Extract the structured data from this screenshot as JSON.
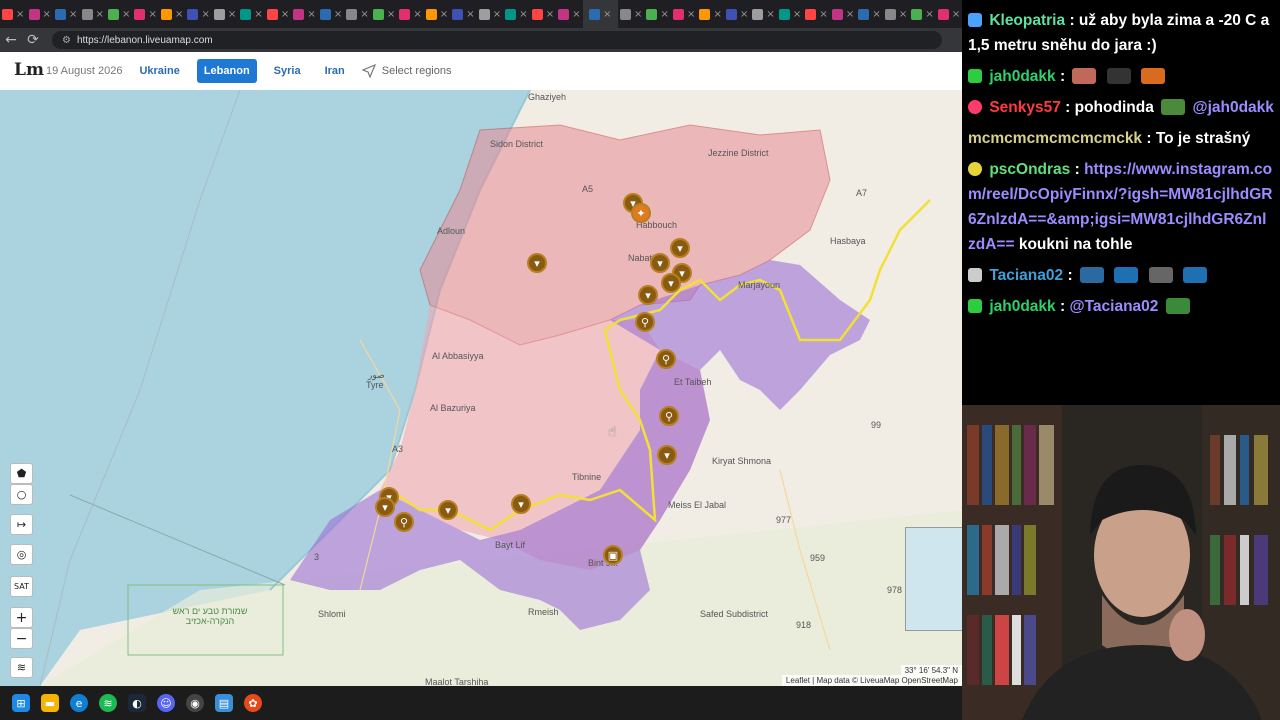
{
  "browser": {
    "url": "https://lebanon.liveuamap.com",
    "tab_count": 36
  },
  "app": {
    "logo": "Lm",
    "date": "19 August 2026",
    "tabs": [
      {
        "label": "Ukraine",
        "active": false
      },
      {
        "label": "Lebanon",
        "active": true
      },
      {
        "label": "Syria",
        "active": false
      },
      {
        "label": "Iran",
        "active": false
      }
    ],
    "select_regions": "Select regions"
  },
  "map": {
    "labels": {
      "ghaziyeh": "Ghaziyeh",
      "sidon_district": "Sidon District",
      "jezzine_district": "Jezzine District",
      "adloun": "Adloun",
      "habbouch": "Habbouch",
      "nabatieh": "Nabatieh",
      "marjayoun": "Marjayoun",
      "hasbaya": "Hasbaya",
      "tyre": "Tyre",
      "tyre_ar": "صور",
      "al_abbasiyya": "Al Abbasiyya",
      "al_bazuriya": "Al Bazuriya",
      "et_taibeh": "Et Taibeh",
      "kiryat_shmona": "Kiryat Shmona",
      "tibnine": "Tibnine",
      "meiss_el_jabal": "Meiss El Jabal",
      "bayt_lif": "Bayt Lif",
      "bint_jbeil": "Bint J...",
      "rmeish": "Rmeish",
      "shlomi": "Shlomi",
      "safed_subdistrict": "Safed Subdistrict",
      "maalot_tarshiha": "Maalot Tarshiha",
      "reserve_he": "שמורת טבע ים ראש הנקרה-אכזיב",
      "a5": "A5",
      "a7": "A7",
      "a3": "A3",
      "r99": "99",
      "r977": "977",
      "r959": "959",
      "r978": "978",
      "r918": "918",
      "r3": "3"
    },
    "controls": {
      "sat": "SAT",
      "zoom_in": "+",
      "zoom_out": "−"
    },
    "coords": "33° 16' 54.3\" N",
    "attribution": "Leaflet | Map data © LiveuaMap OpenStreetMap"
  },
  "chat": {
    "messages": [
      {
        "user": "Kleopatria",
        "user_color": "#5ee0a0",
        "text": ": už aby byla zima a -20 C a 1,5 metru sněhu do jara :)"
      },
      {
        "user": "jah0dakk",
        "user_color": "#2fd06a",
        "text": ":"
      },
      {
        "user": "Senkys57",
        "user_color": "#ff3b3b",
        "text": ": pohodinda",
        "mention": "@jah0dakk"
      },
      {
        "user": "mcmcmcmcmcmcmckk",
        "user_color": "#d7d08a",
        "text": ": To je strašný"
      },
      {
        "user": "pscOndras",
        "user_color": "#60e07a",
        "text": ":",
        "link": "https://www.instagram.com/reel/DcOpiyFinnx/?igsh=MW81cjlhdGR6ZnlzdA==&amp;igsi=MW81cjlhdGR6ZnlzdA==",
        "after": "koukni na tohle"
      },
      {
        "user": "Taciana02",
        "user_color": "#3fa0d8",
        "text": ":"
      },
      {
        "user": "jah0dakk",
        "user_color": "#2fd06a",
        "text": ":",
        "mention": "@Taciana02"
      }
    ]
  },
  "colors": {
    "red_zone": "#e88b96",
    "purple_zone": "#9b6fd6",
    "yellow_line": "#f2e036",
    "marker": "#8a5a10",
    "sea": "#aad3df",
    "land": "#f1ede4"
  }
}
